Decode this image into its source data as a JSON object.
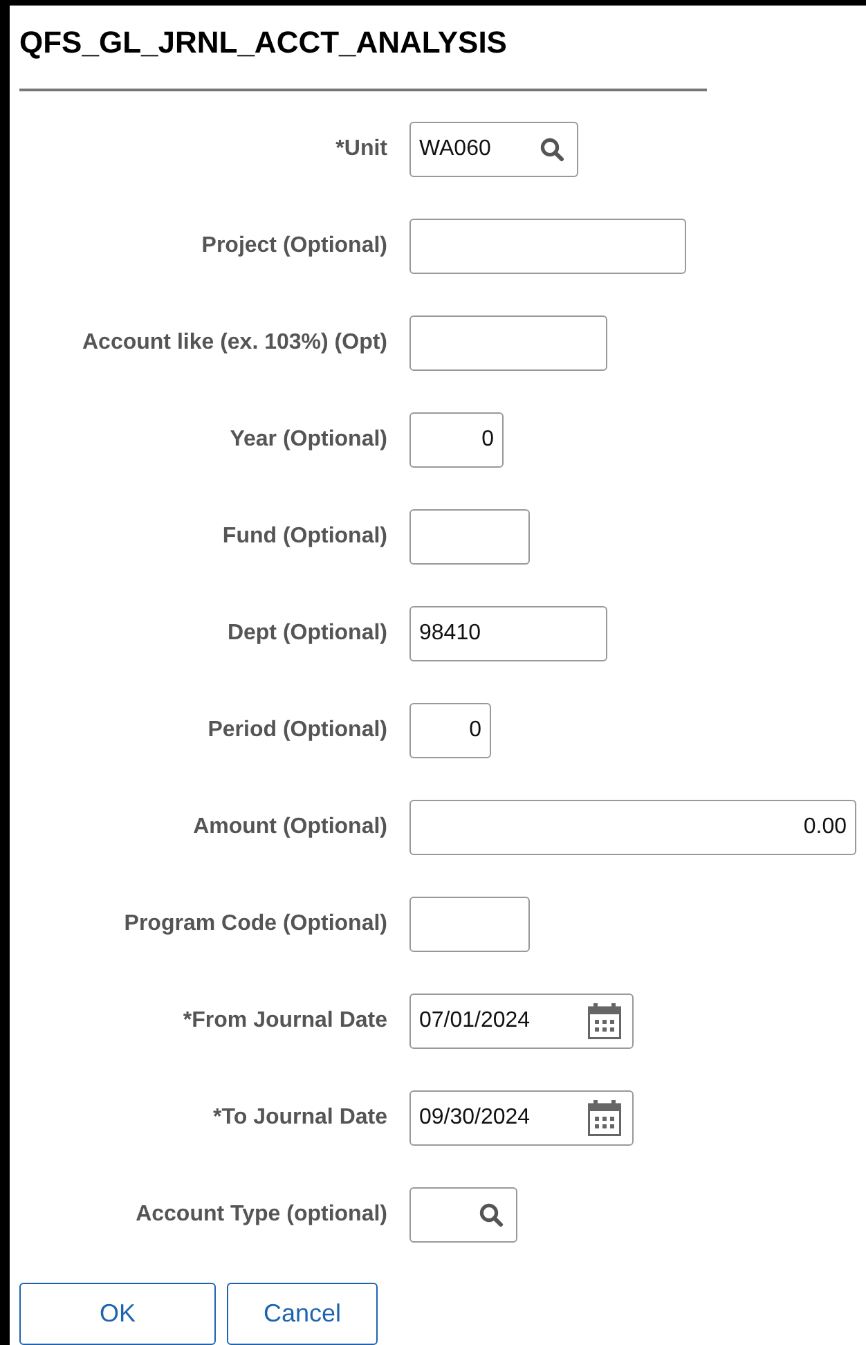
{
  "title": "QFS_GL_JRNL_ACCT_ANALYSIS",
  "fields": [
    {
      "label": "*Unit",
      "kind": "lookup",
      "value": "WA060"
    },
    {
      "label": "Project (Optional)",
      "kind": "text"
    },
    {
      "label": "Account like (ex. 103%) (Opt)",
      "kind": "text"
    },
    {
      "label": "Year (Optional)",
      "kind": "number",
      "value": "0"
    },
    {
      "label": "Fund (Optional)",
      "kind": "text"
    },
    {
      "label": "Dept (Optional)",
      "kind": "text",
      "value": "98410"
    },
    {
      "label": "Period (Optional)",
      "kind": "number",
      "value": "0"
    },
    {
      "label": "Amount (Optional)",
      "kind": "number",
      "value": "0.00"
    },
    {
      "label": "Program Code (Optional)",
      "kind": "text"
    },
    {
      "label": "*From Journal Date",
      "kind": "date",
      "value": "07/01/2024"
    },
    {
      "label": "*To Journal Date",
      "kind": "date",
      "value": "09/30/2024"
    },
    {
      "label": "Account Type (optional)",
      "kind": "lookup"
    }
  ],
  "buttons": [
    "OK",
    "Cancel"
  ]
}
